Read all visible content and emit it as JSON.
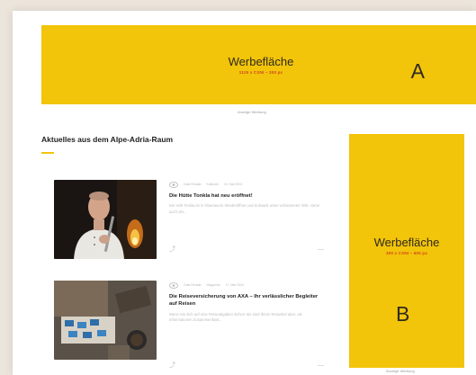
{
  "ads": {
    "a": {
      "title": "Werbefläche",
      "size": "1125 x CXNI – 300 px",
      "letter": "A",
      "caption": "Anzeige Werbung"
    },
    "b": {
      "title": "Werbefläche",
      "size": "300 x CXNI – 600 px",
      "letter": "B",
      "caption": "Anzeige Werbung"
    }
  },
  "section": {
    "title": "Aktuelles aus dem Alpe-Adria-Raum"
  },
  "articles": [
    {
      "author": "Gast Redakt",
      "category": "Kulinarik",
      "date": "15. Mai 2024",
      "title": "Die Hütte Tonkla hat neu eröffnet!",
      "excerpt": "Die Hütt Tonkla ist in Obertauern Wiederöffnet und Kulinarik unter verbesserter Wirt, vorne auch der..."
    },
    {
      "author": "Gast Redakt",
      "category": "Magazine",
      "date": "17. Mai 2024",
      "title": "Die Reiseversicherung von AXA – Ihr verlässlicher Begleiter auf Reisen",
      "excerpt": "Wenn Sie sich auf eine Reiseabgaben sichert Sie sind Ihrem Reisetitel aber, als Informationen Zusammenfass..."
    }
  ],
  "colors": {
    "accent": "#f2c40a",
    "ad_subtitle": "#d1451b",
    "background": "#ece5dc"
  }
}
